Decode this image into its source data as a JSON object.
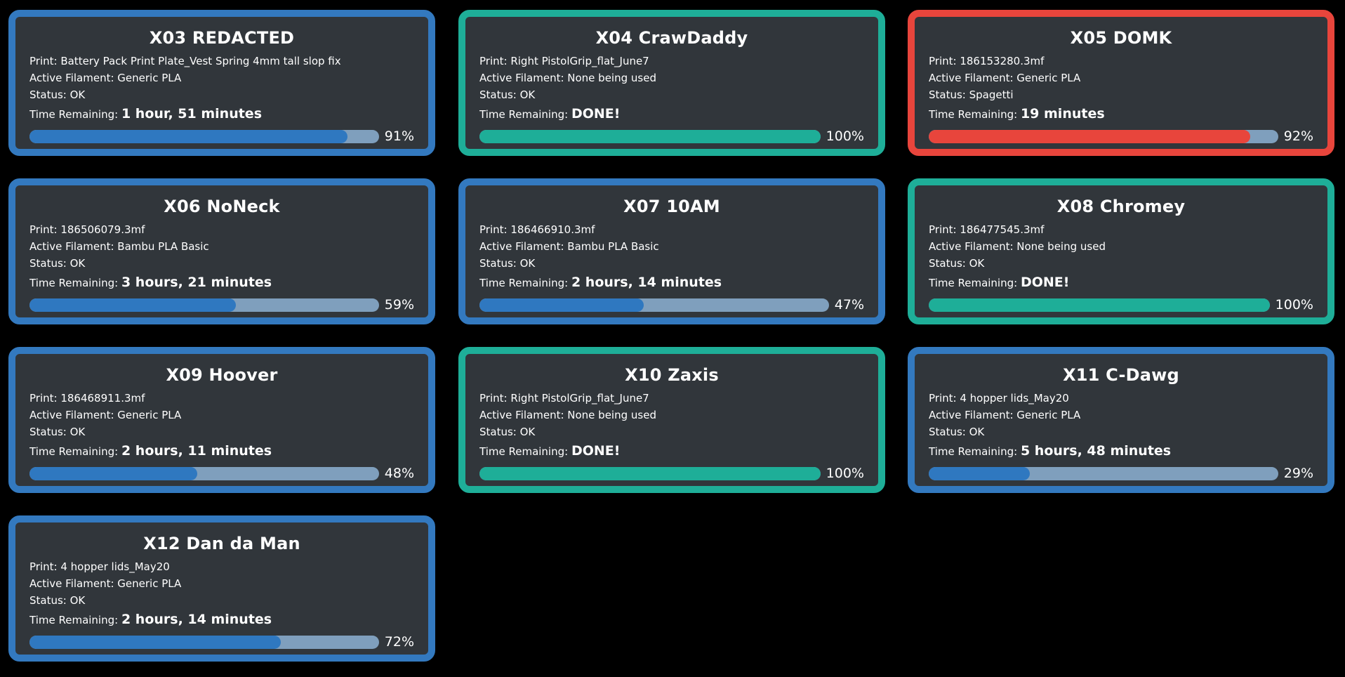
{
  "labels": {
    "print": "Print: ",
    "filament": "Active Filament: ",
    "status": "Status: ",
    "time": "Time Remaining: "
  },
  "colors": {
    "background": "#000000",
    "card_background": "#31363b",
    "printing": "#3379bf",
    "done": "#1eae98",
    "error": "#e8453c",
    "track": "#7f9fbd"
  },
  "printers": [
    {
      "name": "X03 REDACTED",
      "print": "Battery Pack Print Plate_Vest Spring 4mm tall slop fix",
      "filament": "Generic PLA",
      "status": "OK",
      "time": "1 hour, 51 minutes",
      "progress": 91,
      "progress_label": "91%",
      "state": "printing"
    },
    {
      "name": "X04 CrawDaddy",
      "print": "Right PistolGrip_flat_June7",
      "filament": "None being used",
      "status": "OK",
      "time": "DONE!",
      "progress": 100,
      "progress_label": "100%",
      "state": "done"
    },
    {
      "name": "X05 DOMK",
      "print": "186153280.3mf",
      "filament": "Generic PLA",
      "status": "Spagetti",
      "time": "19 minutes",
      "progress": 92,
      "progress_label": "92%",
      "state": "error"
    },
    {
      "name": "X06 NoNeck",
      "print": "186506079.3mf",
      "filament": "Bambu PLA Basic",
      "status": "OK",
      "time": "3 hours, 21 minutes",
      "progress": 59,
      "progress_label": "59%",
      "state": "printing"
    },
    {
      "name": "X07 10AM",
      "print": "186466910.3mf",
      "filament": "Bambu PLA Basic",
      "status": "OK",
      "time": "2 hours, 14 minutes",
      "progress": 47,
      "progress_label": "47%",
      "state": "printing"
    },
    {
      "name": "X08 Chromey",
      "print": "186477545.3mf",
      "filament": "None being used",
      "status": "OK",
      "time": "DONE!",
      "progress": 100,
      "progress_label": "100%",
      "state": "done"
    },
    {
      "name": "X09 Hoover",
      "print": "186468911.3mf",
      "filament": "Generic PLA",
      "status": "OK",
      "time": "2 hours, 11 minutes",
      "progress": 48,
      "progress_label": "48%",
      "state": "printing"
    },
    {
      "name": "X10 Zaxis",
      "print": "Right PistolGrip_flat_June7",
      "filament": "None being used",
      "status": "OK",
      "time": "DONE!",
      "progress": 100,
      "progress_label": "100%",
      "state": "done"
    },
    {
      "name": "X11 C-Dawg",
      "print": "4 hopper lids_May20",
      "filament": "Generic PLA",
      "status": "OK",
      "time": "5 hours, 48 minutes",
      "progress": 29,
      "progress_label": "29%",
      "state": "printing"
    },
    {
      "name": "X12 Dan da Man",
      "print": "4 hopper lids_May20",
      "filament": "Generic PLA",
      "status": "OK",
      "time": "2 hours, 14 minutes",
      "progress": 72,
      "progress_label": "72%",
      "state": "printing"
    }
  ]
}
